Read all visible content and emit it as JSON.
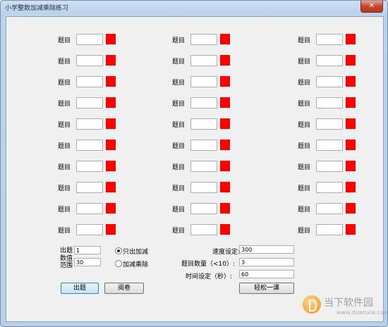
{
  "window": {
    "title": "小学整数加减乘除练习",
    "close_glyph": "✕"
  },
  "question_label": "题目",
  "question_columns": 3,
  "question_rows": 10,
  "indicator_color": "#ff0000",
  "range": {
    "label_line1": "出题",
    "label_line2": "数值",
    "label_line3": "范围",
    "min_value": "1",
    "max_value": "30"
  },
  "mode_options": [
    {
      "label": "只出加减",
      "selected": true
    },
    {
      "label": "加减乘除",
      "selected": false
    }
  ],
  "settings": {
    "speed_label": "速度设定:",
    "speed_value": "300",
    "count_label": "题目数量（<10）:",
    "count_value": "3",
    "time_label": "时间设定（秒）:",
    "time_value": "60"
  },
  "buttons": {
    "generate": "出题",
    "grade": "阅卷",
    "relax": "轻松一课"
  },
  "watermark": {
    "name": "当下软件园",
    "url": "www.downxia.com"
  }
}
